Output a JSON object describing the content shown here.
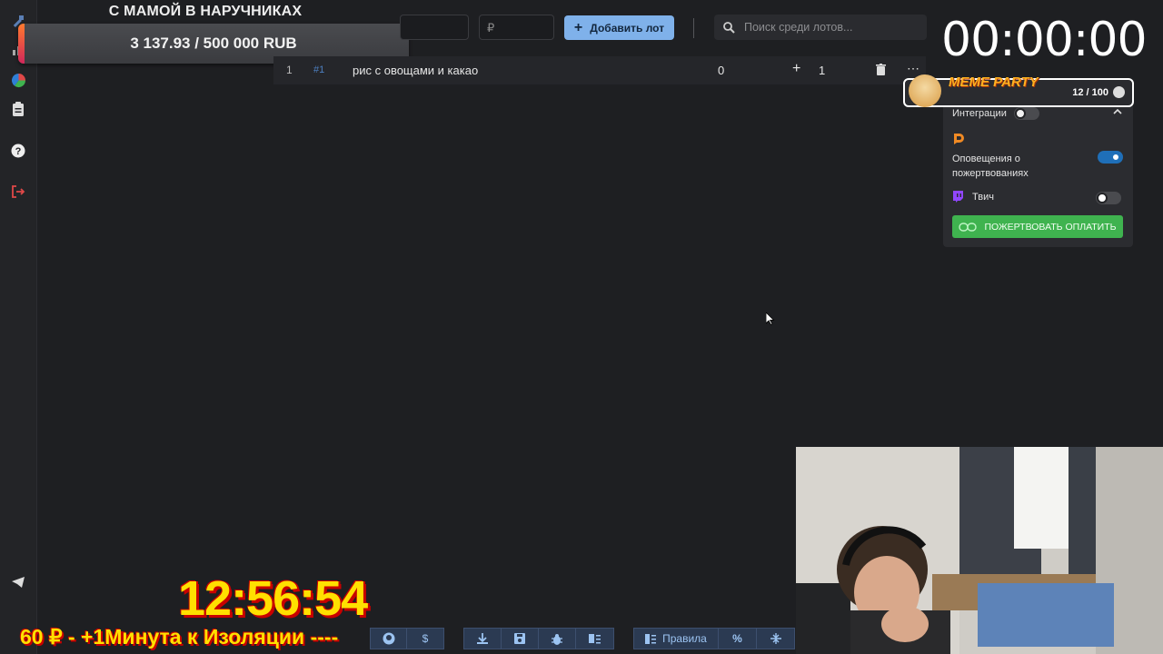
{
  "goal": {
    "title": "С МАМОЙ В НАРУЧНИКАХ",
    "amount": "3 137.93 / 500 000 RUB",
    "progress_fraction": 0.0063
  },
  "toolbar": {
    "currency_placeholder": "₽",
    "add_lot_label": "Добавить лот",
    "search_placeholder": "Поиск среди лотов..."
  },
  "lots": [
    {
      "index": "1",
      "id": "#1",
      "name": "рис с овощами и какао",
      "amount": "0",
      "plus": "+",
      "add_amount": "1"
    }
  ],
  "timer": {
    "value": "00:00:00"
  },
  "meme_party": {
    "title": "MEME PARTY",
    "count": "12 / 100"
  },
  "integrations": {
    "title": "Интеграции",
    "donation_alerts_label": "Оповещения о пожертвованиях",
    "twitch_label": "Твич",
    "donate_button": "ПОЖЕРТВОВАТЬ ОПЛАТИТЬ",
    "colors": {
      "toggle_on": "#1f6fb8",
      "donate": "#3fb34f",
      "donationalerts": "#f08a24",
      "twitch": "#9146ff"
    }
  },
  "overlay": {
    "clock": "12:56:54",
    "ticker": "60 ₽ - +1Минута к Изоляции ----"
  },
  "bottom_bar": {
    "rules_label": "Правила",
    "percent_label": "%"
  },
  "colors": {
    "accent": "#7fb1ea",
    "background": "#1e1f22"
  }
}
